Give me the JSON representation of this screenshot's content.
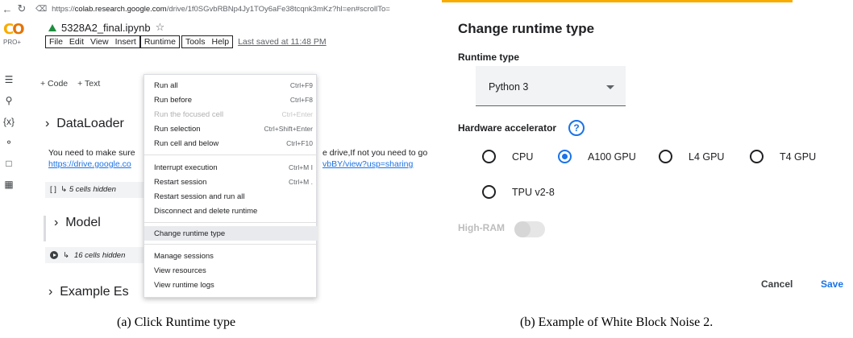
{
  "panel_a": {
    "browser": {
      "back_icon": "arrow-left-icon",
      "reload_icon": "reload-icon",
      "lock_icon": "lock-icon",
      "url_prefix": "https://",
      "url_host": "colab.research.google.com",
      "url_path": "/drive/1f0SGvbRBNp4Jy1TOy6aFe38tcqnk3mKz?hl=en#scrollTo="
    },
    "colab": {
      "logo_text": "CO",
      "plan": "PRO+",
      "notebook_name": "5328A2_final.ipynb",
      "star_icon": "star-icon",
      "menu": [
        "File",
        "Edit",
        "View",
        "Insert",
        "Runtime",
        "Tools",
        "Help"
      ],
      "last_saved": "Last saved at 11:48 PM",
      "add_code": "+ Code",
      "add_text": "+ Text"
    },
    "sidebar_icons": [
      "toc-icon",
      "search-icon",
      "variables-icon",
      "key-icon",
      "folder-icon",
      "calendar-icon"
    ],
    "notebook": {
      "section_dataloader": "DataLoader",
      "text_line1_left": "You need to make sure",
      "text_line1_right": "e drive,If not you need to go",
      "link_left": "https://drive.google.co",
      "link_right": "vbBY/view?usp=sharing",
      "hidden1": "5 cells hidden",
      "hidden1_brackets": "[ ]",
      "section_model": "Model",
      "hidden2": "16 cells hidden",
      "section_example": "Example Es"
    },
    "runtime_menu": [
      {
        "label": "Run all",
        "shortcut": "Ctrl+F9",
        "disabled": false
      },
      {
        "label": "Run before",
        "shortcut": "Ctrl+F8",
        "disabled": false
      },
      {
        "label": "Run the focused cell",
        "shortcut": "Ctrl+Enter",
        "disabled": true
      },
      {
        "label": "Run selection",
        "shortcut": "Ctrl+Shift+Enter",
        "disabled": false
      },
      {
        "label": "Run cell and below",
        "shortcut": "Ctrl+F10",
        "disabled": false
      },
      {
        "label": "Interrupt execution",
        "shortcut": "Ctrl+M I",
        "disabled": false
      },
      {
        "label": "Restart session",
        "shortcut": "Ctrl+M .",
        "disabled": false
      },
      {
        "label": "Restart session and run all",
        "shortcut": "",
        "disabled": false
      },
      {
        "label": "Disconnect and delete runtime",
        "shortcut": "",
        "disabled": false
      },
      {
        "label": "Change runtime type",
        "shortcut": "",
        "disabled": false,
        "highlighted": true
      },
      {
        "label": "Manage sessions",
        "shortcut": "",
        "disabled": false
      },
      {
        "label": "View resources",
        "shortcut": "",
        "disabled": false
      },
      {
        "label": "View runtime logs",
        "shortcut": "",
        "disabled": false
      }
    ],
    "caption": "(a) Click Runtime type"
  },
  "panel_b": {
    "title": "Change runtime type",
    "runtime_type_label": "Runtime type",
    "runtime_type_value": "Python 3",
    "hardware_label": "Hardware accelerator",
    "help_icon": "help-circle-icon",
    "help_glyph": "?",
    "accelerators": [
      {
        "label": "CPU",
        "selected": false
      },
      {
        "label": "A100 GPU",
        "selected": true
      },
      {
        "label": "L4 GPU",
        "selected": false
      },
      {
        "label": "T4 GPU",
        "selected": false
      },
      {
        "label": "TPU v2-8",
        "selected": false
      }
    ],
    "high_ram_label": "High-RAM",
    "high_ram_enabled": false,
    "cancel": "Cancel",
    "save": "Save",
    "accent_color": "#1a73e8",
    "caption": "(b) Example of White Block Noise 2."
  }
}
